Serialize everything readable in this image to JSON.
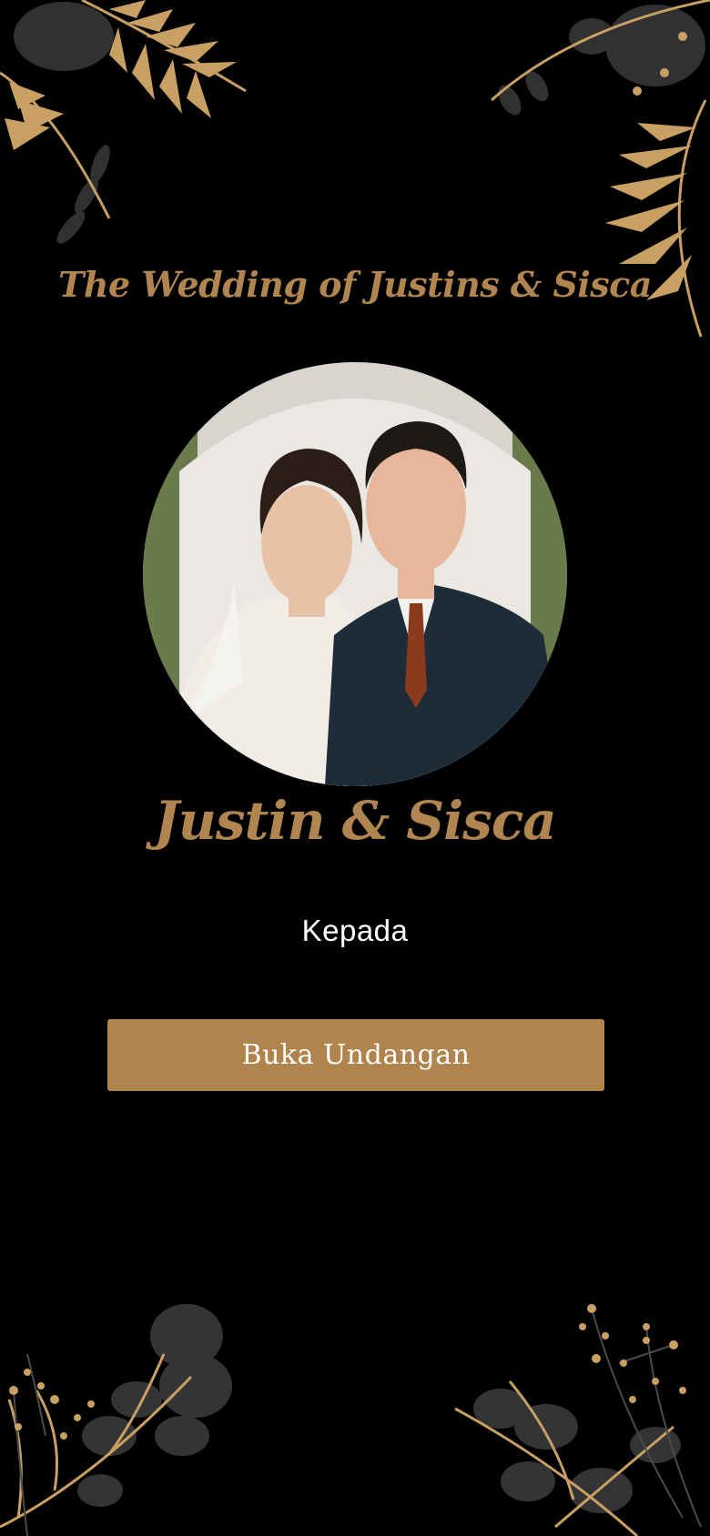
{
  "header": {
    "title": "The Wedding of Justins & Sisca"
  },
  "couple": {
    "names": "Justin & Sisca",
    "photo_alt": "Couple photo"
  },
  "invitation": {
    "recipient_label": "Kepada",
    "open_button_label": "Buka Undangan"
  },
  "theme": {
    "background": "#000000",
    "accent_gold": "#b08550",
    "button_color": "#b0844c",
    "text_white": "#ffffff"
  },
  "decorations": [
    "palm-leaf-corner-top-left",
    "palm-leaf-corner-top-right",
    "berry-branch-corner-bottom-left",
    "berry-branch-corner-bottom-right"
  ]
}
